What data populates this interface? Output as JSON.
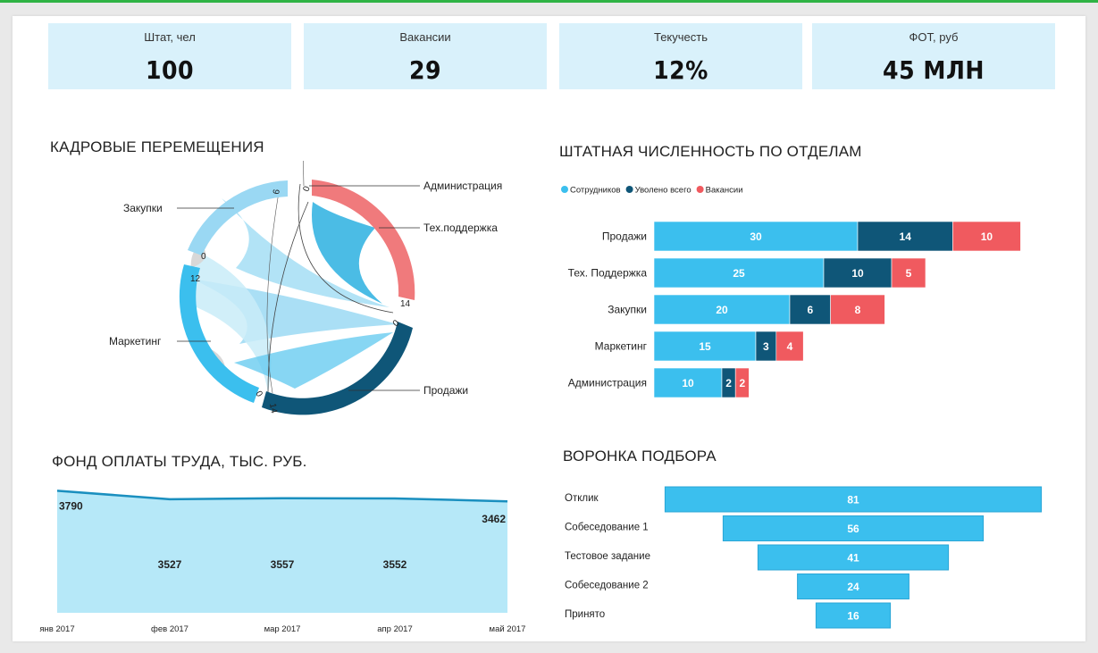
{
  "kpis": [
    {
      "label": "Штат, чел",
      "value": "100"
    },
    {
      "label": "Вакансии",
      "value": "29"
    },
    {
      "label": "Текучесть",
      "value": "12%"
    },
    {
      "label": "ФОТ, руб",
      "value": "45 МЛН"
    }
  ],
  "titles": {
    "chord": "КАДРОВЫЕ ПЕРЕМЕЩЕНИЯ",
    "staff": "ШТАТНАЯ ЧИСЛЕННОСТЬ ПО ОТДЕЛАМ",
    "payroll": "ФОНД ОПЛАТЫ ТРУДА, ТЫС. РУБ.",
    "funnel": "ВОРОНКА ПОДБОРА"
  },
  "colors": {
    "light_blue": "#3bbfee",
    "dark_blue": "#0f5678",
    "red": "#f05a5f",
    "pale_blue": "#b3e6f7",
    "kpi_bg": "#d9f1fb",
    "frame_green": "#2fb344"
  },
  "chart_data": [
    {
      "type": "chord",
      "title": "КАДРОВЫЕ ПЕРЕМЕЩЕНИЯ",
      "groups": [
        "Администрация",
        "Тех.поддержка",
        "Продажи",
        "Маркетинг",
        "Закупки"
      ],
      "tick_labels": [
        "0",
        "14",
        "0",
        "14",
        "0",
        "12",
        "0",
        "6"
      ]
    },
    {
      "type": "bar",
      "stacked": true,
      "orientation": "horizontal",
      "title": "ШТАТНАЯ ЧИСЛЕННОСТЬ ПО ОТДЕЛАМ",
      "categories": [
        "Продажи",
        "Тех. Поддержка",
        "Закупки",
        "Маркетинг",
        "Администрация"
      ],
      "series": [
        {
          "name": "Сотрудников",
          "color": "#3bbfee",
          "values": [
            30,
            25,
            20,
            15,
            10
          ]
        },
        {
          "name": "Уволено всего",
          "color": "#0f5678",
          "values": [
            14,
            10,
            6,
            3,
            2
          ]
        },
        {
          "name": "Вакансии",
          "color": "#f05a5f",
          "values": [
            10,
            5,
            8,
            4,
            2
          ]
        }
      ],
      "legend": "top-left"
    },
    {
      "type": "area",
      "title": "ФОНД ОПЛАТЫ ТРУДА, ТЫС. РУБ.",
      "x": [
        "янв 2017",
        "фев 2017",
        "мар 2017",
        "апр 2017",
        "май 2017"
      ],
      "values": [
        3790,
        3527,
        3557,
        3552,
        3462
      ]
    },
    {
      "type": "bar",
      "subtype": "funnel",
      "title": "ВОРОНКА ПОДБОРА",
      "categories": [
        "Отклик",
        "Собеседование 1",
        "Тестовое задание",
        "Собеседование 2",
        "Принято"
      ],
      "values": [
        81,
        56,
        41,
        24,
        16
      ]
    }
  ]
}
